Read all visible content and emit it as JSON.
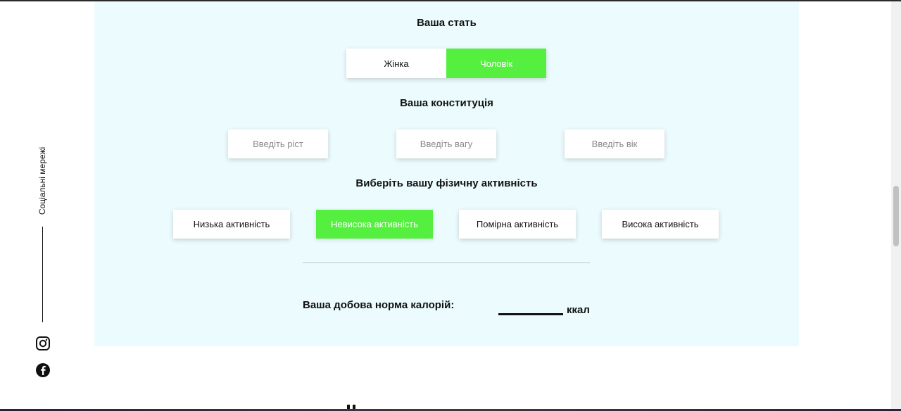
{
  "social": {
    "label": "Соціальні мережі",
    "icons": [
      "instagram-icon",
      "facebook-icon"
    ]
  },
  "calculator": {
    "sex": {
      "heading": "Ваша стать",
      "options": [
        "Жінка",
        "Чоловік"
      ],
      "selected": "Чоловік"
    },
    "constitution": {
      "heading": "Ваша конституція",
      "height_placeholder": "Введіть ріст",
      "weight_placeholder": "Введіть вагу",
      "age_placeholder": "Введіть вік"
    },
    "activity": {
      "heading": "Виберіть вашу фізичну активність",
      "options": [
        "Низька активність",
        "Невисока активність",
        "Помірна активність",
        "Висока активність"
      ],
      "selected": "Невисока активність"
    },
    "result": {
      "label": "Ваша добова норма калорій:",
      "value": "",
      "unit": "ккал"
    }
  },
  "colors": {
    "accent": "#55f03f",
    "panel_bg": "#ecfcfe"
  }
}
